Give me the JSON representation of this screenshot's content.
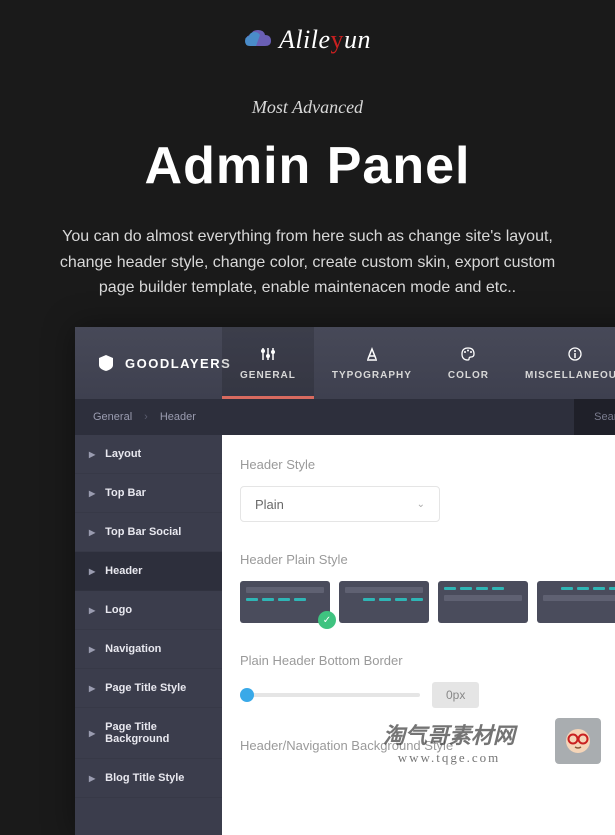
{
  "logo": {
    "text_pre": "Alile",
    "text_accent": "y",
    "text_post": "un"
  },
  "hero": {
    "subtitle": "Most Advanced",
    "title": "Admin Panel",
    "description": "You can do almost everything from here such as change site's layout, change header style, change color, create custom skin, export custom page builder template, enable maintenacen mode and etc.."
  },
  "panel": {
    "brand": "GOODLAYERS",
    "tabs": [
      {
        "label": "GENERAL",
        "icon": "sliders-icon",
        "active": true
      },
      {
        "label": "TYPOGRAPHY",
        "icon": "font-icon",
        "active": false
      },
      {
        "label": "COLOR",
        "icon": "palette-icon",
        "active": false
      },
      {
        "label": "MISCELLANEOUS",
        "icon": "info-icon",
        "active": false
      }
    ],
    "breadcrumb": {
      "root": "General",
      "current": "Header"
    },
    "search_placeholder": "Search Options",
    "sidebar": [
      {
        "label": "Layout",
        "active": false
      },
      {
        "label": "Top Bar",
        "active": false
      },
      {
        "label": "Top Bar Social",
        "active": false
      },
      {
        "label": "Header",
        "active": true
      },
      {
        "label": "Logo",
        "active": false
      },
      {
        "label": "Navigation",
        "active": false
      },
      {
        "label": "Page Title Style",
        "active": false
      },
      {
        "label": "Page Title Background",
        "active": false
      },
      {
        "label": "Blog Title Style",
        "active": false
      }
    ],
    "content": {
      "header_style": {
        "label": "Header Style",
        "value": "Plain"
      },
      "plain_style": {
        "label": "Header Plain Style",
        "selected_index": 0
      },
      "bottom_border": {
        "label": "Plain Header Bottom Border",
        "value": "0px"
      },
      "nav_bg": {
        "label": "Header/Navigation Background Style"
      }
    }
  },
  "watermark": {
    "line1": "淘气哥素材网",
    "line2": "www.tqge.com"
  }
}
